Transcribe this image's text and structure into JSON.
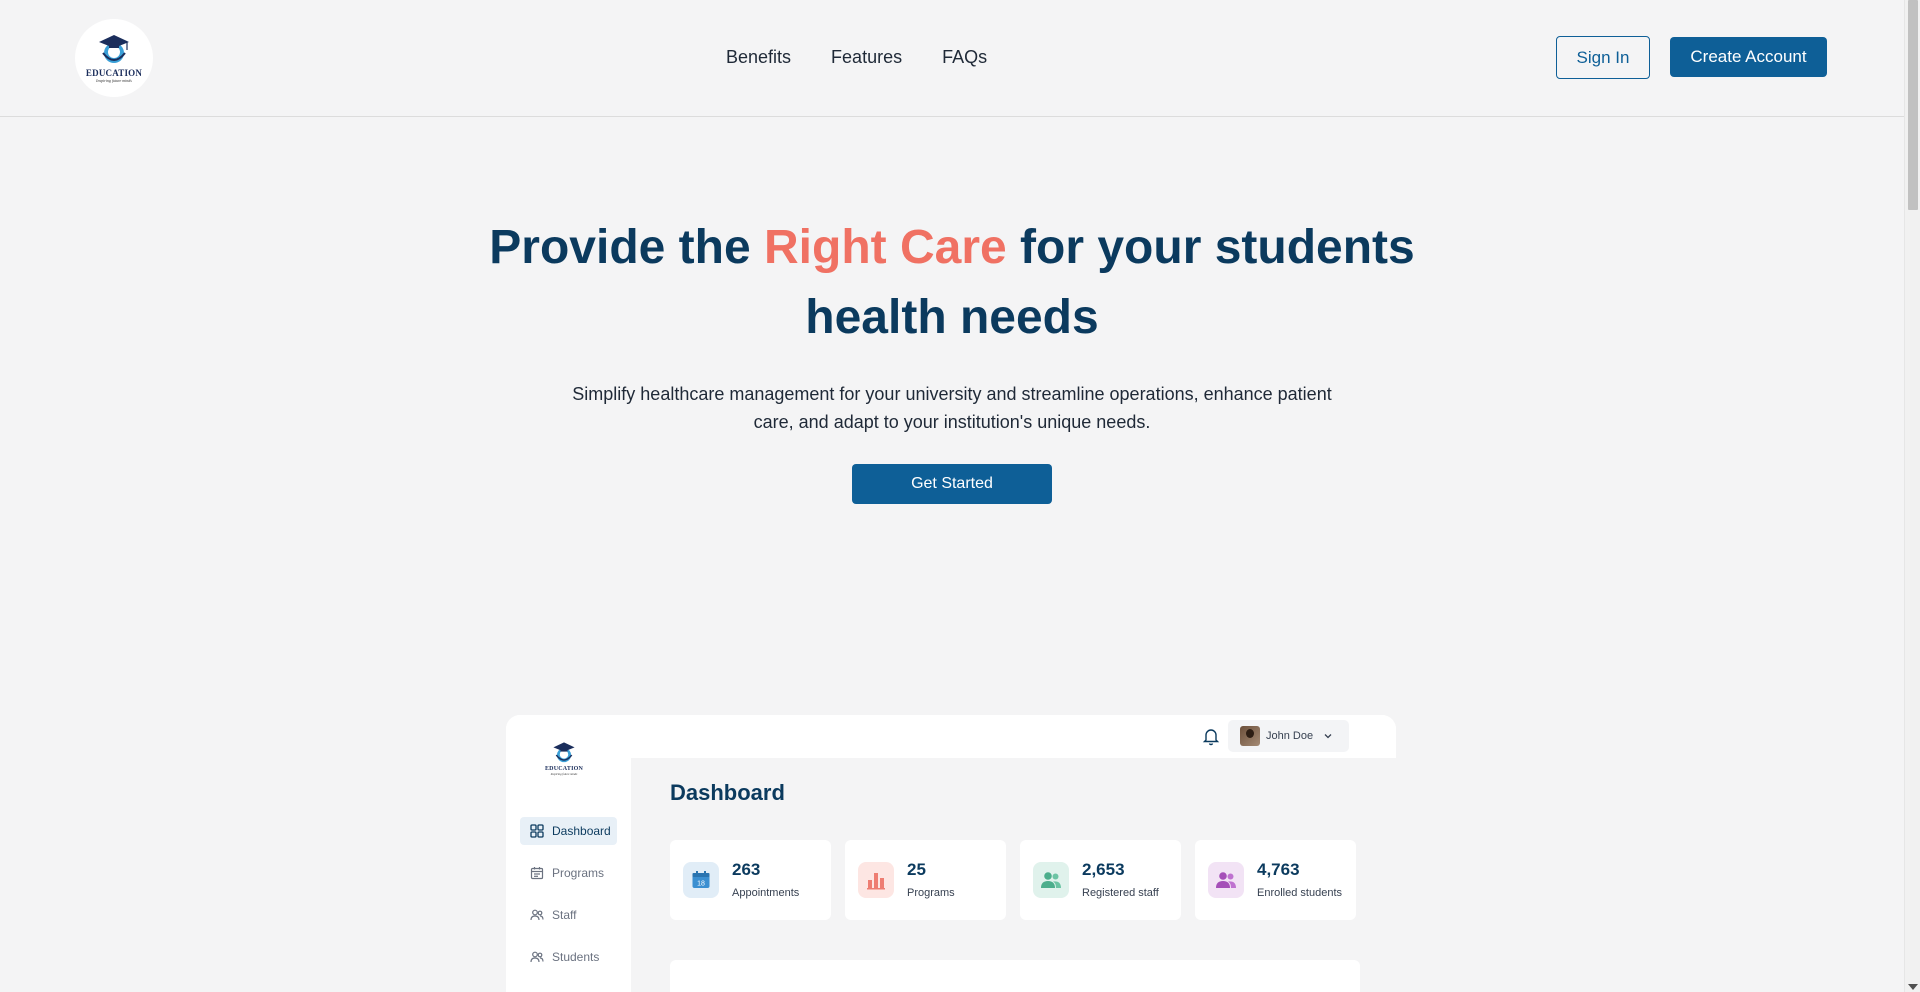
{
  "header": {
    "logo": {
      "word": "EDUCATION",
      "tagline": "Inspiring future minds"
    },
    "nav": [
      "Benefits",
      "Features",
      "FAQs"
    ],
    "sign_in": "Sign In",
    "create_account": "Create Account"
  },
  "hero": {
    "title_part1": "Provide the ",
    "title_accent": "Right Care",
    "title_part2": " for your students health needs",
    "subtitle": "Simplify healthcare management for your university and streamline operations, enhance patient care, and adapt to your institution's unique needs.",
    "cta": "Get Started"
  },
  "dashboard": {
    "logo": {
      "word": "EDUCATION",
      "tagline": "Inspiring future minds"
    },
    "sidebar": [
      {
        "label": "Dashboard",
        "icon": "grid-icon",
        "active": true
      },
      {
        "label": "Programs",
        "icon": "calendar-icon",
        "active": false
      },
      {
        "label": "Staff",
        "icon": "users-icon",
        "active": false
      },
      {
        "label": "Students",
        "icon": "users-icon",
        "active": false
      }
    ],
    "user": {
      "name": "John Doe"
    },
    "title": "Dashboard",
    "stats": [
      {
        "value": "263",
        "label": "Appointments",
        "icon": "calendar-icon",
        "icon_text": "18",
        "bg": "#e1edf7",
        "fg": "#3b8fd1"
      },
      {
        "value": "25",
        "label": "Programs",
        "icon": "bar-chart-icon",
        "bg": "#fde6e3",
        "fg": "#ee7d72"
      },
      {
        "value": "2,653",
        "label": "Registered staff",
        "icon": "users-icon",
        "bg": "#e0f2ec",
        "fg": "#4cae8c"
      },
      {
        "value": "4,763",
        "label": "Enrolled students",
        "icon": "users-icon",
        "bg": "#f2e3f5",
        "fg": "#a54fb8"
      }
    ]
  },
  "colors": {
    "primary": "#0e5f97",
    "heading": "#0b3a5e",
    "accent": "#f07163",
    "background": "#f4f4f5"
  }
}
